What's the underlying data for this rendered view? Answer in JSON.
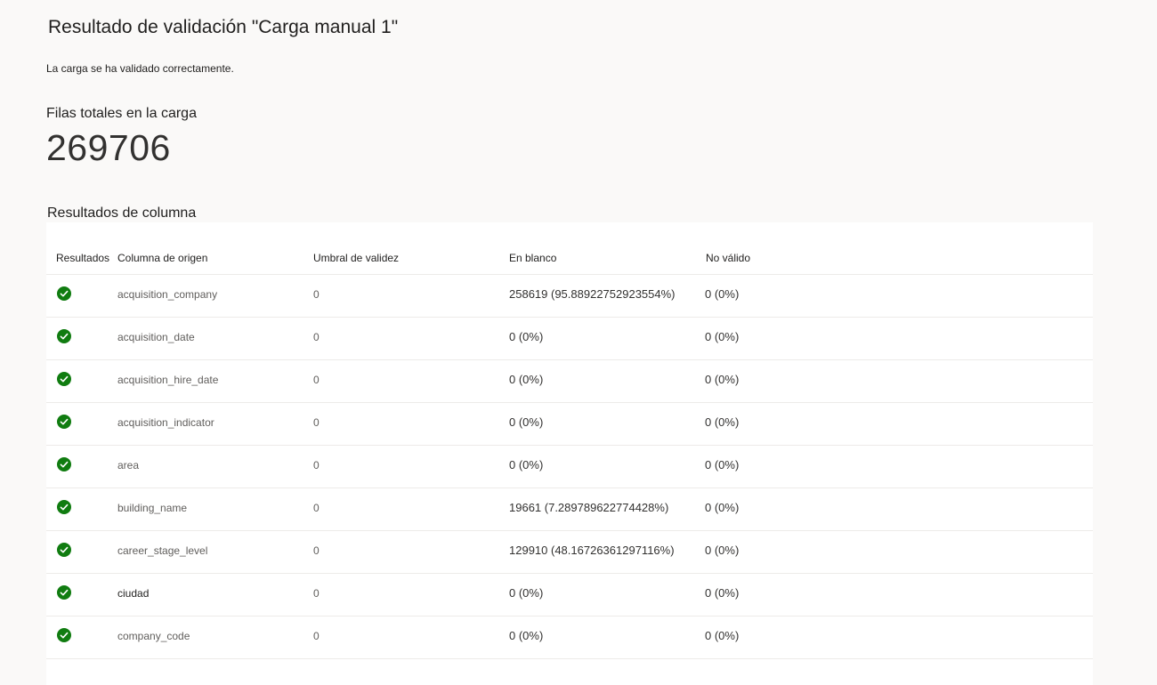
{
  "page": {
    "title": "Resultado de validación \"Carga manual 1\"",
    "status_message": "La carga se ha validado correctamente.",
    "total_rows_label": "Filas totales en la carga",
    "total_rows_value": "269706",
    "section_title": "Resultados de columna"
  },
  "colors": {
    "success": "#107c10",
    "background": "#faf9f8"
  },
  "table": {
    "headers": {
      "results": "Resultados",
      "source_column": "Columna de origen",
      "threshold": "Umbral de validez",
      "blank": "En blanco",
      "invalid": "No válido"
    },
    "rows": [
      {
        "status_icon": "success-check-icon",
        "column": "acquisition_company",
        "threshold": "0",
        "blank": "258619 (95.88922752923554%)",
        "invalid": "0 (0%)"
      },
      {
        "status_icon": "success-check-icon",
        "column": "acquisition_date",
        "threshold": "0",
        "blank": "0 (0%)",
        "invalid": "0 (0%)"
      },
      {
        "status_icon": "success-check-icon",
        "column": "acquisition_hire_date",
        "threshold": "0",
        "blank": "0 (0%)",
        "invalid": "0 (0%)"
      },
      {
        "status_icon": "success-check-icon",
        "column": "acquisition_indicator",
        "threshold": "0",
        "blank": "0 (0%)",
        "invalid": "0 (0%)"
      },
      {
        "status_icon": "success-check-icon",
        "column": "area",
        "threshold": "0",
        "blank": "0 (0%)",
        "invalid": "0 (0%)"
      },
      {
        "status_icon": "success-check-icon",
        "column": "building_name",
        "threshold": "0",
        "blank": "19661 (7.289789622774428%)",
        "invalid": "0 (0%)"
      },
      {
        "status_icon": "success-check-icon",
        "column": "career_stage_level",
        "threshold": "0",
        "blank": "129910 (48.16726361297116%)",
        "invalid": "0 (0%)"
      },
      {
        "status_icon": "success-check-icon",
        "column": "ciudad",
        "threshold": "0",
        "blank": "0 (0%)",
        "invalid": "0 (0%)"
      },
      {
        "status_icon": "success-check-icon",
        "column": "company_code",
        "threshold": "0",
        "blank": "0 (0%)",
        "invalid": "0 (0%)"
      }
    ]
  }
}
